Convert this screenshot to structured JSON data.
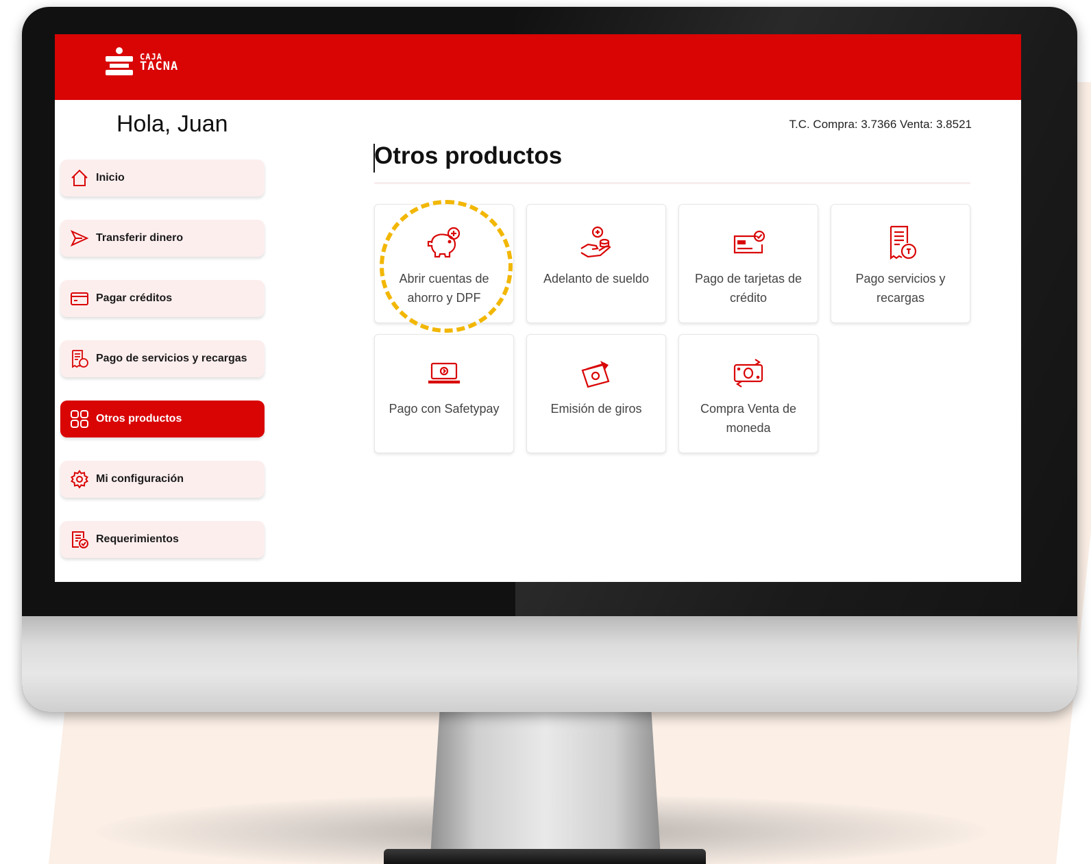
{
  "app": {
    "logo_line1": "CAJA",
    "logo_line2": "TACNA",
    "greeting": "Hola, Juan",
    "exchange_rate": "T.C. Compra: 3.7366 Venta: 3.8521",
    "section_title": "Otros productos"
  },
  "sidebar": {
    "items": [
      {
        "label": "Inicio",
        "icon": "home-icon"
      },
      {
        "label": "Transferir dinero",
        "icon": "send-icon"
      },
      {
        "label": "Pagar créditos",
        "icon": "credit-card-icon"
      },
      {
        "label": "Pago de servicios y recargas",
        "icon": "receipt-soles-icon"
      },
      {
        "label": "Otros productos",
        "icon": "grid-icon",
        "active": true
      },
      {
        "label": "Mi configuración",
        "icon": "gear-icon"
      },
      {
        "label": "Requerimientos",
        "icon": "document-check-icon"
      }
    ]
  },
  "products": [
    {
      "label": "Abrir cuentas de ahorro y DPF",
      "icon": "piggy-bank-plus-icon"
    },
    {
      "label": "Adelanto de sueldo",
      "icon": "hand-coins-icon"
    },
    {
      "label": "Pago de tarjetas de crédito",
      "icon": "card-check-icon"
    },
    {
      "label": "Pago servicios y recargas",
      "icon": "receipt-soles-icon"
    },
    {
      "label": "Pago con Safetypay",
      "icon": "laptop-pay-icon"
    },
    {
      "label": "Emisión de giros",
      "icon": "money-transfer-icon"
    },
    {
      "label": "Compra Venta de moneda",
      "icon": "currency-exchange-icon"
    }
  ],
  "colors": {
    "brand_red": "#d90404",
    "nav_bg": "#fdeeee",
    "highlight": "#f2b705"
  }
}
